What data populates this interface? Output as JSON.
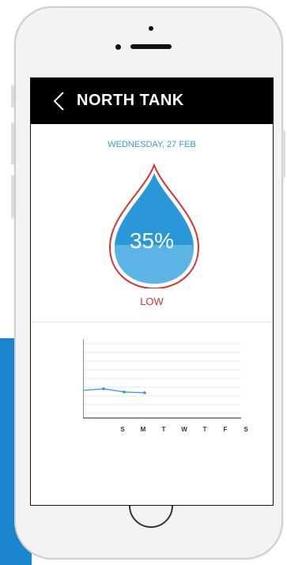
{
  "screen": {
    "title": "NORTH TANK",
    "date": "WEDNESDAY, 27 FEB",
    "level_percent_label": "35%",
    "level_fraction": 0.35,
    "status": "LOW"
  },
  "chart_data": {
    "type": "line",
    "categories": [
      "S",
      "M",
      "T",
      "W",
      "T",
      "F",
      "S"
    ],
    "series": [
      {
        "values": [
          0.35,
          0.37,
          0.33,
          0.32,
          null,
          null,
          null
        ]
      }
    ],
    "ylim": [
      0,
      1
    ],
    "grid": true
  },
  "colors": {
    "accent": "#3a9ad8",
    "water": "#2a97d8",
    "drop_outline": "#d7332b",
    "status": "#d7332b",
    "nav_bar": "#000000",
    "side_panel": "#1a86d0"
  },
  "icons": {
    "back": "chevron-left-icon",
    "drop": "water-drop-icon",
    "home": "home-button"
  }
}
